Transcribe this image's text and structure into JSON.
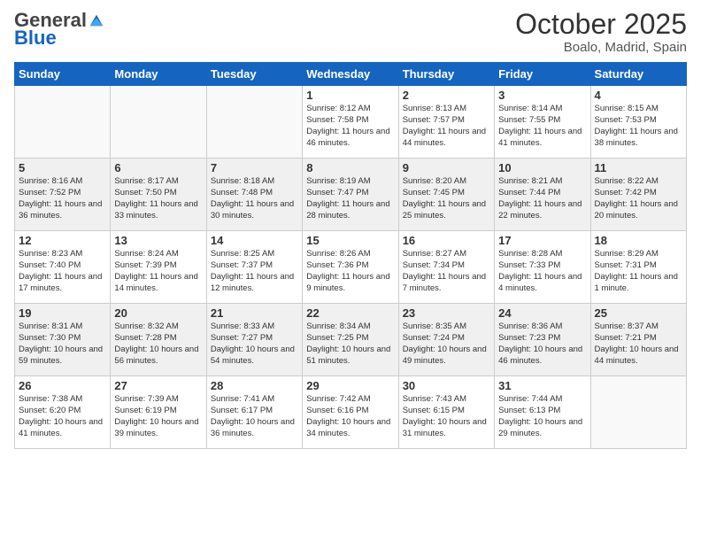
{
  "header": {
    "logo_general": "General",
    "logo_blue": "Blue",
    "month_title": "October 2025",
    "location": "Boalo, Madrid, Spain"
  },
  "weekdays": [
    "Sunday",
    "Monday",
    "Tuesday",
    "Wednesday",
    "Thursday",
    "Friday",
    "Saturday"
  ],
  "weeks": [
    [
      {
        "day": "",
        "sunrise": "",
        "sunset": "",
        "daylight": ""
      },
      {
        "day": "",
        "sunrise": "",
        "sunset": "",
        "daylight": ""
      },
      {
        "day": "",
        "sunrise": "",
        "sunset": "",
        "daylight": ""
      },
      {
        "day": "1",
        "sunrise": "Sunrise: 8:12 AM",
        "sunset": "Sunset: 7:58 PM",
        "daylight": "Daylight: 11 hours and 46 minutes."
      },
      {
        "day": "2",
        "sunrise": "Sunrise: 8:13 AM",
        "sunset": "Sunset: 7:57 PM",
        "daylight": "Daylight: 11 hours and 44 minutes."
      },
      {
        "day": "3",
        "sunrise": "Sunrise: 8:14 AM",
        "sunset": "Sunset: 7:55 PM",
        "daylight": "Daylight: 11 hours and 41 minutes."
      },
      {
        "day": "4",
        "sunrise": "Sunrise: 8:15 AM",
        "sunset": "Sunset: 7:53 PM",
        "daylight": "Daylight: 11 hours and 38 minutes."
      }
    ],
    [
      {
        "day": "5",
        "sunrise": "Sunrise: 8:16 AM",
        "sunset": "Sunset: 7:52 PM",
        "daylight": "Daylight: 11 hours and 36 minutes."
      },
      {
        "day": "6",
        "sunrise": "Sunrise: 8:17 AM",
        "sunset": "Sunset: 7:50 PM",
        "daylight": "Daylight: 11 hours and 33 minutes."
      },
      {
        "day": "7",
        "sunrise": "Sunrise: 8:18 AM",
        "sunset": "Sunset: 7:48 PM",
        "daylight": "Daylight: 11 hours and 30 minutes."
      },
      {
        "day": "8",
        "sunrise": "Sunrise: 8:19 AM",
        "sunset": "Sunset: 7:47 PM",
        "daylight": "Daylight: 11 hours and 28 minutes."
      },
      {
        "day": "9",
        "sunrise": "Sunrise: 8:20 AM",
        "sunset": "Sunset: 7:45 PM",
        "daylight": "Daylight: 11 hours and 25 minutes."
      },
      {
        "day": "10",
        "sunrise": "Sunrise: 8:21 AM",
        "sunset": "Sunset: 7:44 PM",
        "daylight": "Daylight: 11 hours and 22 minutes."
      },
      {
        "day": "11",
        "sunrise": "Sunrise: 8:22 AM",
        "sunset": "Sunset: 7:42 PM",
        "daylight": "Daylight: 11 hours and 20 minutes."
      }
    ],
    [
      {
        "day": "12",
        "sunrise": "Sunrise: 8:23 AM",
        "sunset": "Sunset: 7:40 PM",
        "daylight": "Daylight: 11 hours and 17 minutes."
      },
      {
        "day": "13",
        "sunrise": "Sunrise: 8:24 AM",
        "sunset": "Sunset: 7:39 PM",
        "daylight": "Daylight: 11 hours and 14 minutes."
      },
      {
        "day": "14",
        "sunrise": "Sunrise: 8:25 AM",
        "sunset": "Sunset: 7:37 PM",
        "daylight": "Daylight: 11 hours and 12 minutes."
      },
      {
        "day": "15",
        "sunrise": "Sunrise: 8:26 AM",
        "sunset": "Sunset: 7:36 PM",
        "daylight": "Daylight: 11 hours and 9 minutes."
      },
      {
        "day": "16",
        "sunrise": "Sunrise: 8:27 AM",
        "sunset": "Sunset: 7:34 PM",
        "daylight": "Daylight: 11 hours and 7 minutes."
      },
      {
        "day": "17",
        "sunrise": "Sunrise: 8:28 AM",
        "sunset": "Sunset: 7:33 PM",
        "daylight": "Daylight: 11 hours and 4 minutes."
      },
      {
        "day": "18",
        "sunrise": "Sunrise: 8:29 AM",
        "sunset": "Sunset: 7:31 PM",
        "daylight": "Daylight: 11 hours and 1 minute."
      }
    ],
    [
      {
        "day": "19",
        "sunrise": "Sunrise: 8:31 AM",
        "sunset": "Sunset: 7:30 PM",
        "daylight": "Daylight: 10 hours and 59 minutes."
      },
      {
        "day": "20",
        "sunrise": "Sunrise: 8:32 AM",
        "sunset": "Sunset: 7:28 PM",
        "daylight": "Daylight: 10 hours and 56 minutes."
      },
      {
        "day": "21",
        "sunrise": "Sunrise: 8:33 AM",
        "sunset": "Sunset: 7:27 PM",
        "daylight": "Daylight: 10 hours and 54 minutes."
      },
      {
        "day": "22",
        "sunrise": "Sunrise: 8:34 AM",
        "sunset": "Sunset: 7:25 PM",
        "daylight": "Daylight: 10 hours and 51 minutes."
      },
      {
        "day": "23",
        "sunrise": "Sunrise: 8:35 AM",
        "sunset": "Sunset: 7:24 PM",
        "daylight": "Daylight: 10 hours and 49 minutes."
      },
      {
        "day": "24",
        "sunrise": "Sunrise: 8:36 AM",
        "sunset": "Sunset: 7:23 PM",
        "daylight": "Daylight: 10 hours and 46 minutes."
      },
      {
        "day": "25",
        "sunrise": "Sunrise: 8:37 AM",
        "sunset": "Sunset: 7:21 PM",
        "daylight": "Daylight: 10 hours and 44 minutes."
      }
    ],
    [
      {
        "day": "26",
        "sunrise": "Sunrise: 7:38 AM",
        "sunset": "Sunset: 6:20 PM",
        "daylight": "Daylight: 10 hours and 41 minutes."
      },
      {
        "day": "27",
        "sunrise": "Sunrise: 7:39 AM",
        "sunset": "Sunset: 6:19 PM",
        "daylight": "Daylight: 10 hours and 39 minutes."
      },
      {
        "day": "28",
        "sunrise": "Sunrise: 7:41 AM",
        "sunset": "Sunset: 6:17 PM",
        "daylight": "Daylight: 10 hours and 36 minutes."
      },
      {
        "day": "29",
        "sunrise": "Sunrise: 7:42 AM",
        "sunset": "Sunset: 6:16 PM",
        "daylight": "Daylight: 10 hours and 34 minutes."
      },
      {
        "day": "30",
        "sunrise": "Sunrise: 7:43 AM",
        "sunset": "Sunset: 6:15 PM",
        "daylight": "Daylight: 10 hours and 31 minutes."
      },
      {
        "day": "31",
        "sunrise": "Sunrise: 7:44 AM",
        "sunset": "Sunset: 6:13 PM",
        "daylight": "Daylight: 10 hours and 29 minutes."
      },
      {
        "day": "",
        "sunrise": "",
        "sunset": "",
        "daylight": ""
      }
    ]
  ]
}
